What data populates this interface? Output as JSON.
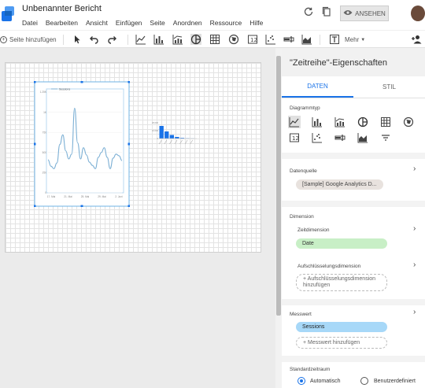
{
  "app": {
    "title": "Unbenannter Bericht",
    "menu": [
      "Datei",
      "Bearbeiten",
      "Ansicht",
      "Einfügen",
      "Seite",
      "Anordnen",
      "Ressource",
      "Hilfe"
    ],
    "view_button": "ANSEHEN"
  },
  "toolbar": {
    "add_page_label": "Seite hinzufügen",
    "more_label": "Mehr"
  },
  "chart_main": {
    "legend": "Sessions",
    "y_ticks": [
      "1.25K",
      "1K",
      "750",
      "500",
      "250",
      "0"
    ],
    "x_ticks": [
      "17. Mai",
      "21. Mai",
      "25. Mai",
      "29. Mai",
      "2. Juni"
    ]
  },
  "chart_small": {
    "y_ticks": [
      "20.000",
      "10.000",
      "0"
    ]
  },
  "chart_data": [
    {
      "type": "line",
      "legend": [
        "Sessions"
      ],
      "x": [
        "17. Mai",
        "21. Mai",
        "25. Mai",
        "29. Mai",
        "2. Juni"
      ],
      "series": [
        {
          "name": "Sessions",
          "values": [
            410,
            330,
            300,
            370,
            600,
            720,
            520,
            420,
            480,
            1050,
            620,
            420,
            560,
            470,
            380,
            340,
            300,
            440,
            500,
            560,
            440,
            300,
            430,
            480,
            460,
            400
          ]
        }
      ],
      "ylim": [
        0,
        1250
      ]
    },
    {
      "type": "bar",
      "categories": [
        "",
        "",
        "",
        "",
        "",
        "",
        ""
      ],
      "values": [
        16000,
        9000,
        4500,
        2000,
        800,
        300,
        150
      ],
      "ylim": [
        0,
        20000
      ]
    }
  ],
  "panel": {
    "title": "\"Zeitreihe\"-Eigenschaften",
    "tab_data": "DATEN",
    "tab_style": "STIL",
    "chart_type_label": "Diagrammtyp",
    "chart_types": [
      "timeseries-icon",
      "bar-chart-icon",
      "combo-chart-icon",
      "pie-chart-icon",
      "table-icon",
      "geo-map-icon",
      "scorecard-icon",
      "scatter-icon",
      "bullet-icon",
      "area-chart-icon",
      "filter-icon"
    ],
    "datasource_label": "Datenquelle",
    "datasource_value": "[Sample] Google Analytics D...",
    "dimension_label": "Dimension",
    "time_dimension_label": "Zeitdimension",
    "time_dimension_value": "Date",
    "breakdown_label": "Aufschlüsselungsdimension",
    "breakdown_add": "+ Aufschlüsselungsdimension hinzufügen",
    "metric_label": "Messwert",
    "metric_value": "Sessions",
    "metric_add": "+ Messwert hinzufügen",
    "daterange_label": "Standardzeitraum",
    "daterange_auto": "Automatisch",
    "daterange_custom": "Benutzerdefiniert"
  }
}
